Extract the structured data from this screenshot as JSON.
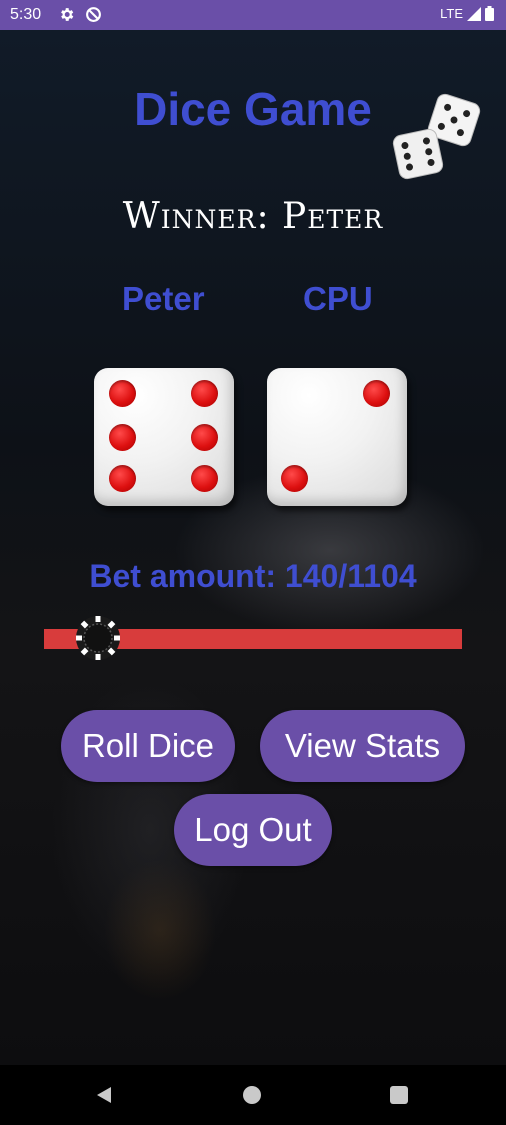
{
  "status_bar": {
    "time": "5:30",
    "network": "LTE",
    "icons": [
      "gear-icon",
      "no-entry-icon",
      "signal-icon",
      "battery-icon"
    ]
  },
  "app": {
    "title": "Dice Game",
    "winner_text": "Winner: Peter",
    "players": [
      {
        "name": "Peter",
        "die_value": 6
      },
      {
        "name": "CPU",
        "die_value": 2
      }
    ],
    "bet_label": "Bet amount: 140/1104",
    "bet": {
      "value": 140,
      "max": 1104
    },
    "buttons": {
      "roll": "Roll Dice",
      "stats": "View Stats",
      "logout": "Log Out"
    }
  },
  "colors": {
    "accent": "#3f4ed1",
    "button": "#6a4fa8",
    "status_bar": "#6a4fa8",
    "slider_track": "#d83c3c",
    "pip": "#dd1010"
  },
  "nav": [
    "back-icon",
    "home-icon",
    "recents-icon"
  ]
}
